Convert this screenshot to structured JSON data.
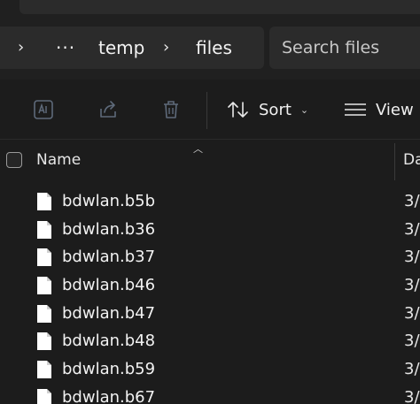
{
  "breadcrumb": {
    "overflow": "···",
    "items": [
      "temp",
      "files"
    ]
  },
  "search": {
    "placeholder": "Search files"
  },
  "toolbar": {
    "sort_label": "Sort",
    "view_label": "View"
  },
  "columns": {
    "name": "Name",
    "date": "Da"
  },
  "files": [
    {
      "name": "bdwlan.b5b",
      "date": "3/"
    },
    {
      "name": "bdwlan.b36",
      "date": "3/"
    },
    {
      "name": "bdwlan.b37",
      "date": "3/"
    },
    {
      "name": "bdwlan.b46",
      "date": "3/"
    },
    {
      "name": "bdwlan.b47",
      "date": "3/"
    },
    {
      "name": "bdwlan.b48",
      "date": "3/"
    },
    {
      "name": "bdwlan.b59",
      "date": "3/"
    },
    {
      "name": "bdwlan.b67",
      "date": "3/"
    }
  ],
  "colors": {
    "background": "#1c1c1c",
    "panel": "#2b2b2b",
    "text": "#f2f2f2",
    "disabled_icon": "#5e6a7a"
  },
  "icons": {
    "toolbar": [
      "translate-icon",
      "share-icon",
      "trash-icon",
      "sort-icon",
      "view-list-icon"
    ],
    "file": "document-icon"
  }
}
